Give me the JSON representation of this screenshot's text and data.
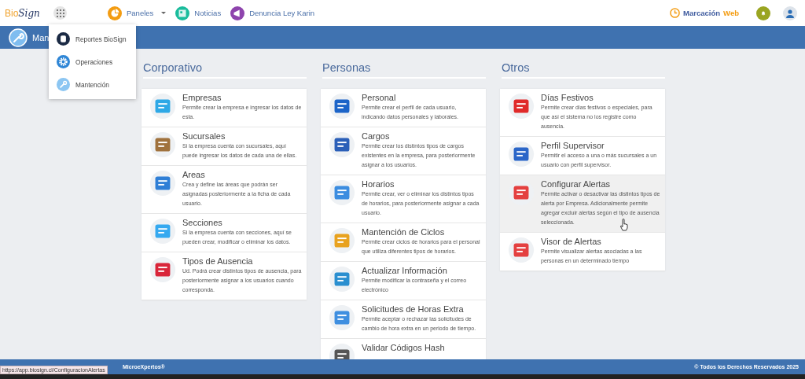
{
  "header": {
    "logo": [
      "Bio",
      "Sign"
    ],
    "nav": [
      {
        "label": "Paneles",
        "dropdown": true
      },
      {
        "label": "Noticias",
        "dropdown": false
      },
      {
        "label": "Denuncia Ley Karin",
        "dropdown": false
      }
    ],
    "marcacion": [
      "Marcación",
      "Web"
    ]
  },
  "page_bar": {
    "title": "Man"
  },
  "apps_menu": {
    "items": [
      "Reportes BioSign",
      "Operaciones",
      "Mantención"
    ]
  },
  "sections": [
    {
      "title": "Corporativo",
      "items": [
        {
          "title": "Empresas",
          "description": "Permite crear la empresa e ingresar los datos de esta.",
          "highlighted": false
        },
        {
          "title": "Sucursales",
          "description": "Si la empresa cuenta con sucursales, aquí puede ingresar los datos de cada una de ellas.",
          "highlighted": false
        },
        {
          "title": "Areas",
          "description": "Crea y define las áreas que podrán ser asignadas posteriormente a la ficha de cada usuario.",
          "highlighted": false
        },
        {
          "title": "Secciones",
          "description": "Si la empresa cuenta con secciones, aquí se pueden crear, modificar o eliminar los datos.",
          "highlighted": false
        },
        {
          "title": "Tipos de Ausencia",
          "description": "Ud. Podrá crear distintos tipos de ausencia, para posteriormente asignar a los usuarios cuando corresponda.",
          "highlighted": false
        }
      ]
    },
    {
      "title": "Personas",
      "items": [
        {
          "title": "Personal",
          "description": "Permite crear el perfil de cada usuario, indicando datos personales y laborales.",
          "highlighted": false
        },
        {
          "title": "Cargos",
          "description": "Permite crear los distintos tipos de cargos existentes en la empresa, para posteriormente asignar a los usuarios.",
          "highlighted": false
        },
        {
          "title": "Horarios",
          "description": "Permite crear, ver o eliminar los distintos tipos de horarios, para posteriormente asignar a cada usuario.",
          "highlighted": false
        },
        {
          "title": "Mantención de Ciclos",
          "description": "Permite crear ciclos de horarios para el personal que utiliza diferentes tipos de horarios.",
          "highlighted": false
        },
        {
          "title": "Actualizar Información",
          "description": "Permite modificar la contraseña y el correo electrónico",
          "highlighted": false
        },
        {
          "title": "Solicitudes de Horas Extra",
          "description": "Permite aceptar o rechazar las solicitudes de cambio de hora extra en un periodo de tiempo.",
          "highlighted": false
        },
        {
          "title": "Validar Códigos Hash",
          "highlighted": false
        }
      ]
    },
    {
      "title": "Otros",
      "items": [
        {
          "title": "Días Festivos",
          "description": "Permite crear días festivos o especiales, para que así el sistema no los registre como ausencia.",
          "highlighted": false
        },
        {
          "title": "Perfil Supervisor",
          "description": "Permitir el acceso a una o más sucursales a un usuario con perfil supervisor.",
          "highlighted": false
        },
        {
          "title": "Configurar Alertas",
          "description": "Permite activar o desactivar las distintos tipos de alerta por Empresa. Adicionalmente permite agregar excluir alertas según el tipo de ausencia seleccionada.",
          "highlighted": true
        },
        {
          "title": "Visor de Alertas",
          "description": "Permite visualizar alertas asociadas a las personas en un determinado tiempo",
          "highlighted": false
        }
      ]
    }
  ],
  "footer": {
    "left": "MicroeXpertos®",
    "right": "© Todos los Derechos Reservados 2025"
  },
  "status_url": "https://app.biosign.cl/ConfiguracionAlertas"
}
